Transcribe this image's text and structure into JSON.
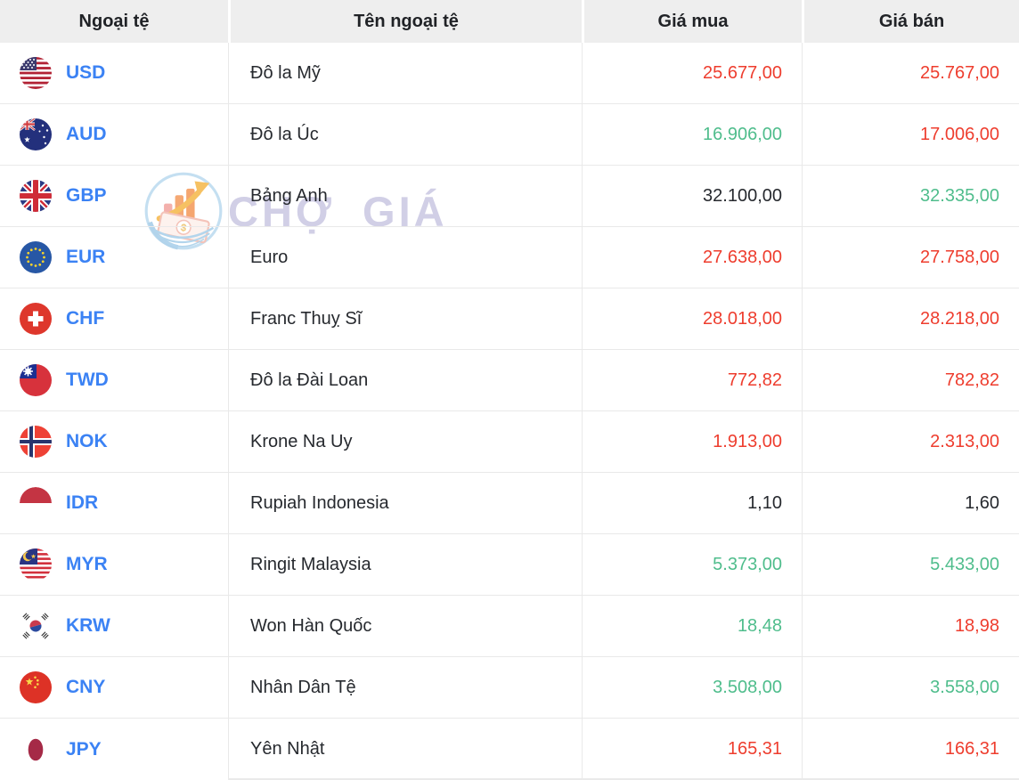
{
  "colors": {
    "red": "#ee3d2e",
    "green": "#4fbd8c",
    "blue": "#3b82f4",
    "dark": "#26292e",
    "header_bg": "#eeeeee",
    "border": "#e9e9e9",
    "watermark": "#c9c7e2"
  },
  "header": {
    "columns": [
      "Ngoại tệ",
      "Tên ngoại tệ",
      "Giá mua",
      "Giá bán"
    ]
  },
  "watermark": {
    "text": "CHỢ GIÁ",
    "logo_icon": "chogia-chart-money-logo-icon"
  },
  "rows": [
    {
      "code": "USD",
      "flag": "us-flag",
      "name": "Đô la Mỹ",
      "buy": "25.677,00",
      "buy_color": "red",
      "sell": "25.767,00",
      "sell_color": "red"
    },
    {
      "code": "AUD",
      "flag": "au-flag",
      "name": "Đô la Úc",
      "buy": "16.906,00",
      "buy_color": "green",
      "sell": "17.006,00",
      "sell_color": "red"
    },
    {
      "code": "GBP",
      "flag": "gb-flag",
      "name": "Bảng Anh",
      "buy": "32.100,00",
      "buy_color": "dark",
      "sell": "32.335,00",
      "sell_color": "green"
    },
    {
      "code": "EUR",
      "flag": "eu-flag",
      "name": "Euro",
      "buy": "27.638,00",
      "buy_color": "red",
      "sell": "27.758,00",
      "sell_color": "red"
    },
    {
      "code": "CHF",
      "flag": "ch-flag",
      "name": "Franc Thuỵ Sĩ",
      "buy": "28.018,00",
      "buy_color": "red",
      "sell": "28.218,00",
      "sell_color": "red"
    },
    {
      "code": "TWD",
      "flag": "tw-flag",
      "name": "Đô la Đài Loan",
      "buy": "772,82",
      "buy_color": "red",
      "sell": "782,82",
      "sell_color": "red"
    },
    {
      "code": "NOK",
      "flag": "no-flag",
      "name": "Krone Na Uy",
      "buy": "1.913,00",
      "buy_color": "red",
      "sell": "2.313,00",
      "sell_color": "red"
    },
    {
      "code": "IDR",
      "flag": "id-flag",
      "name": "Rupiah Indonesia",
      "buy": "1,10",
      "buy_color": "dark",
      "sell": "1,60",
      "sell_color": "dark"
    },
    {
      "code": "MYR",
      "flag": "my-flag",
      "name": "Ringit Malaysia",
      "buy": "5.373,00",
      "buy_color": "green",
      "sell": "5.433,00",
      "sell_color": "green"
    },
    {
      "code": "KRW",
      "flag": "kr-flag",
      "name": "Won Hàn Quốc",
      "buy": "18,48",
      "buy_color": "green",
      "sell": "18,98",
      "sell_color": "red"
    },
    {
      "code": "CNY",
      "flag": "cn-flag",
      "name": "Nhân Dân Tệ",
      "buy": "3.508,00",
      "buy_color": "green",
      "sell": "3.558,00",
      "sell_color": "green"
    },
    {
      "code": "JPY",
      "flag": "jp-flag",
      "name": "Yên Nhật",
      "buy": "165,31",
      "buy_color": "red",
      "sell": "166,31",
      "sell_color": "red"
    }
  ]
}
